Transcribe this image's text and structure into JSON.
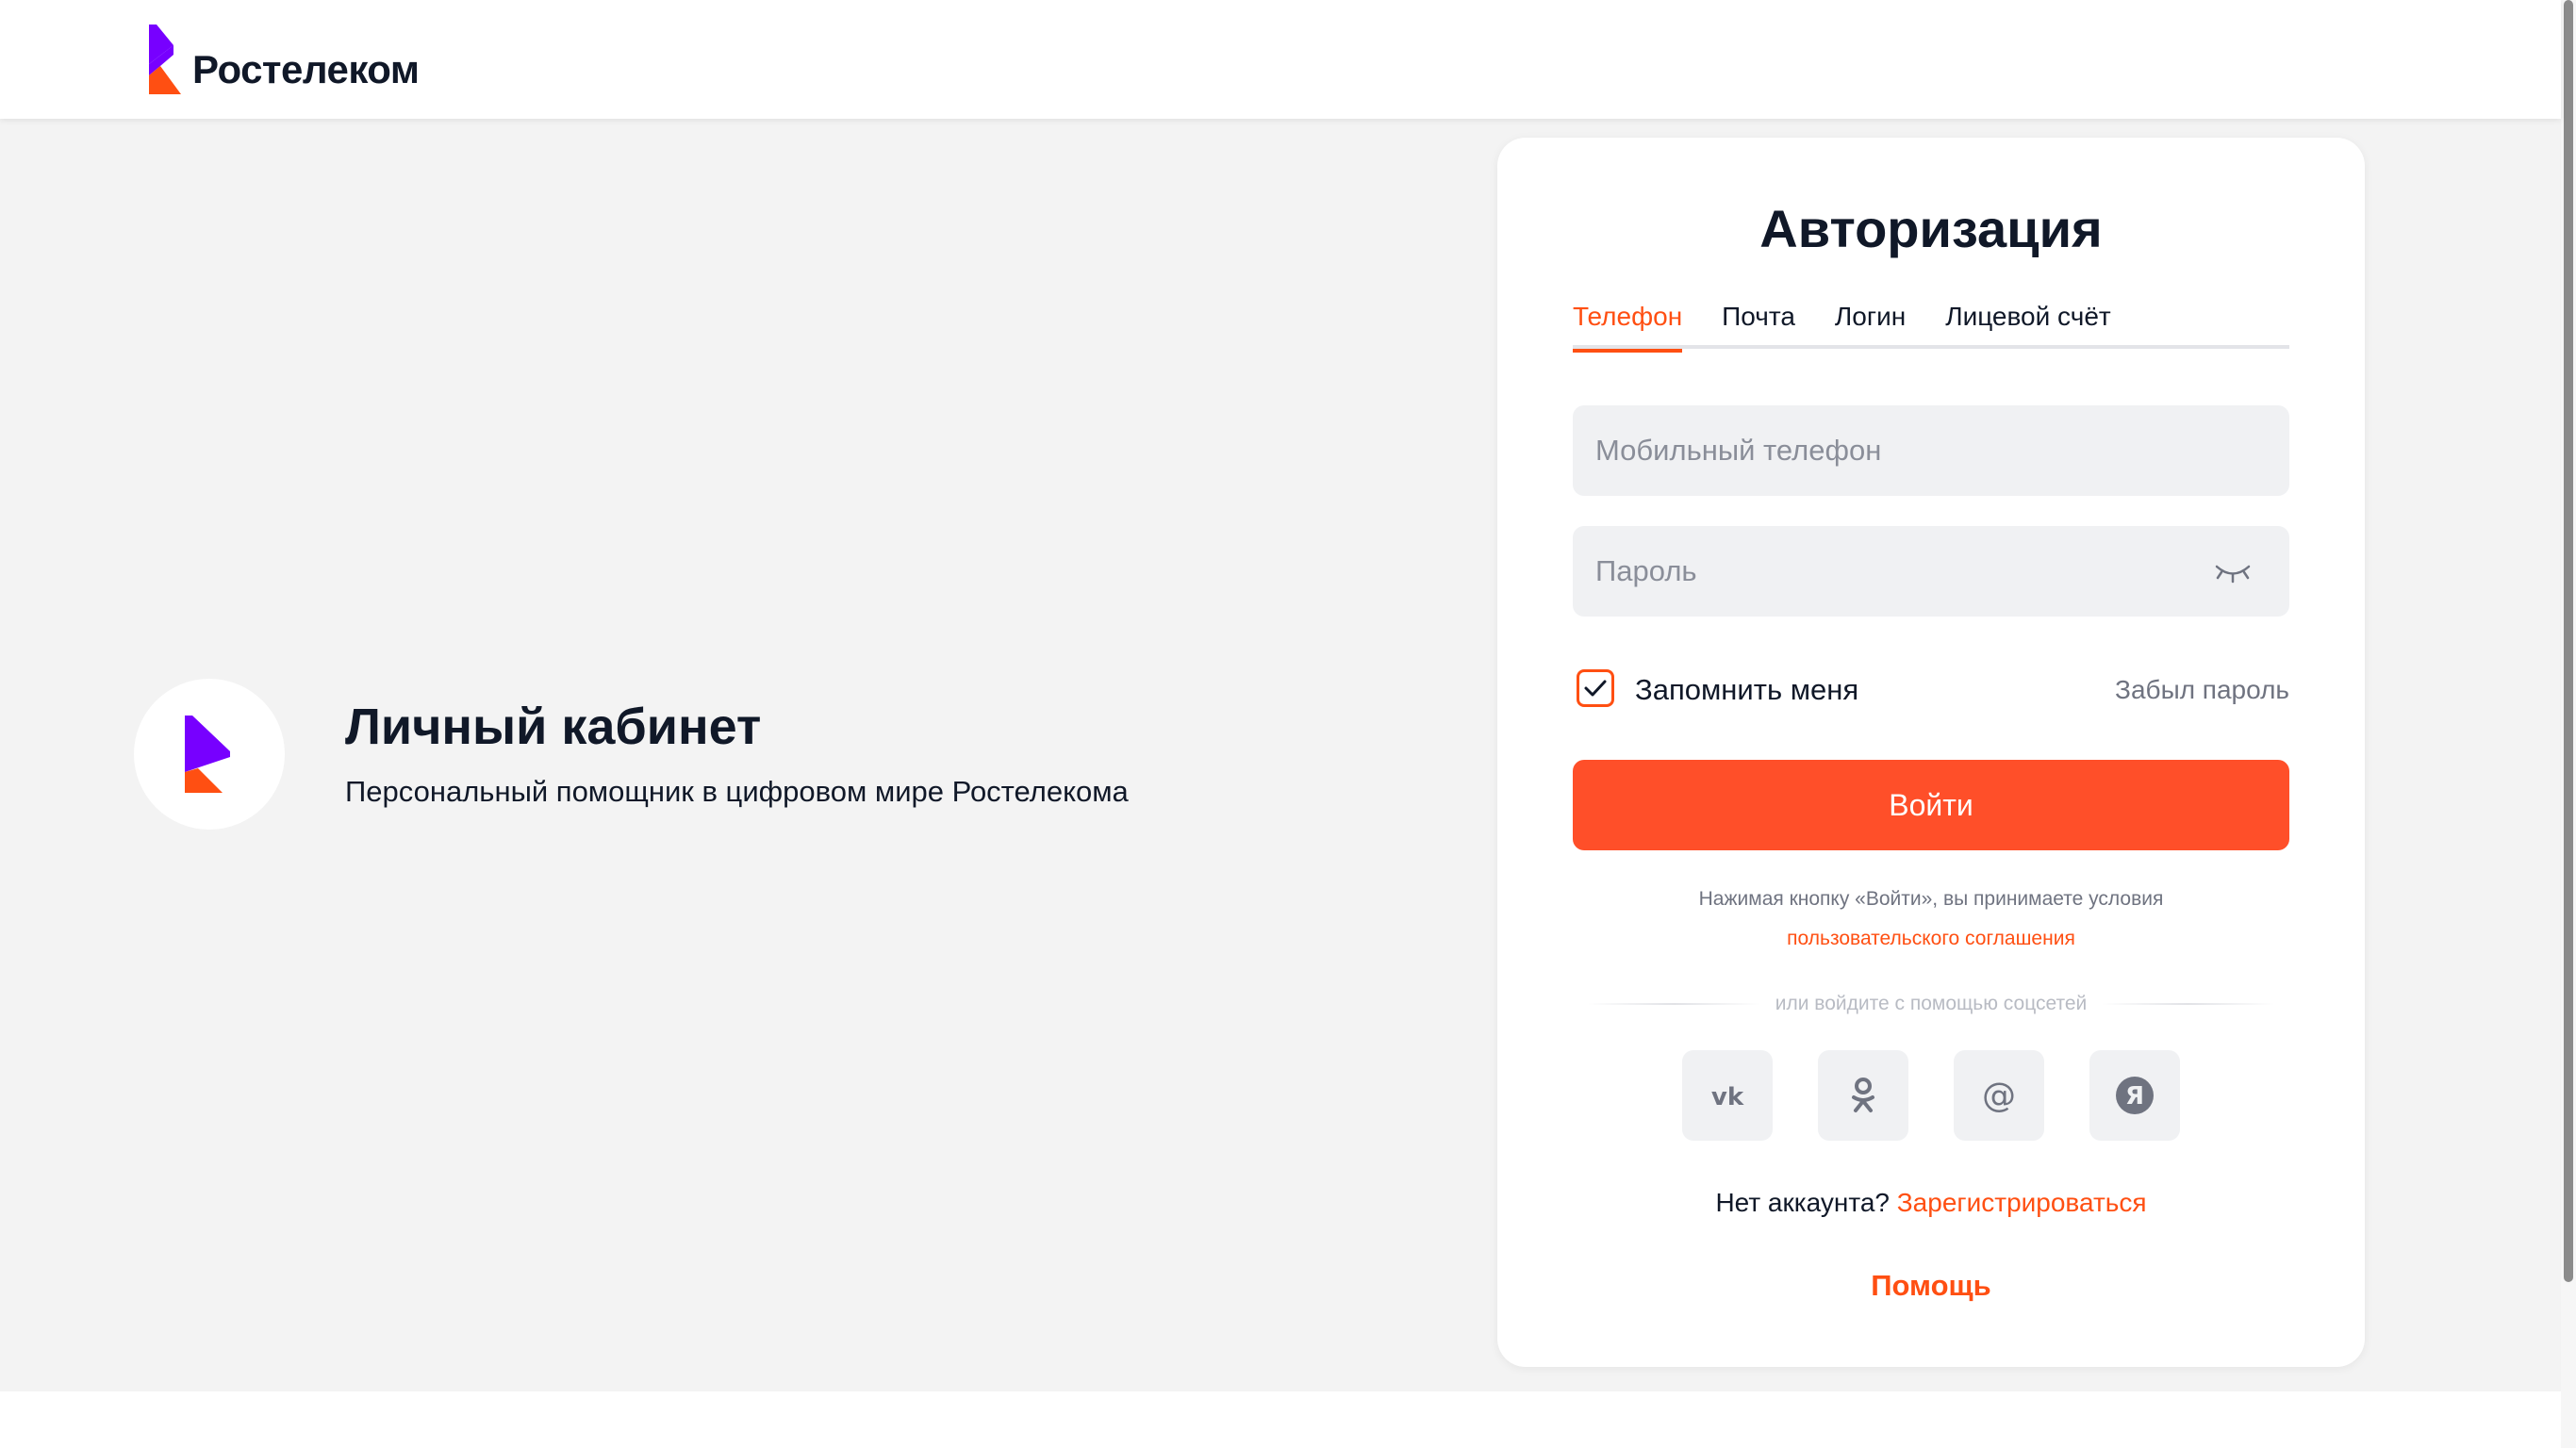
{
  "header": {
    "brand_name": "Ростелеком"
  },
  "intro": {
    "title": "Личный кабинет",
    "subtitle": "Персональный помощник в цифровом мире Ростелекома"
  },
  "auth": {
    "title": "Авторизация",
    "tabs": [
      {
        "label": "Телефон",
        "active": true
      },
      {
        "label": "Почта",
        "active": false
      },
      {
        "label": "Логин",
        "active": false
      },
      {
        "label": "Лицевой счёт",
        "active": false
      }
    ],
    "phone_placeholder": "Мобильный телефон",
    "phone_value": "",
    "password_placeholder": "Пароль",
    "password_value": "",
    "password_toggle_icon": "eye-closed-icon",
    "remember_label": "Запомнить меня",
    "remember_checked": true,
    "forgot_label": "Забыл пароль",
    "login_label": "Войти",
    "terms_text": "Нажимая кнопку «Войти», вы принимаете условия",
    "terms_link": "пользовательского соглашения",
    "social_divider": "или войдите с помощью соцсетей",
    "socials": [
      {
        "icon": "vk-icon"
      },
      {
        "icon": "odnoklassniki-icon"
      },
      {
        "icon": "mail-ru-icon"
      },
      {
        "icon": "yandex-icon"
      }
    ],
    "register_prompt": "Нет аккаунта?",
    "register_link": "Зарегистрироваться",
    "help_label": "Помощь"
  },
  "colors": {
    "accent": "#ff4f12",
    "brand_purple": "#7700ff",
    "background": "#f3f3f3",
    "text": "#101828"
  }
}
